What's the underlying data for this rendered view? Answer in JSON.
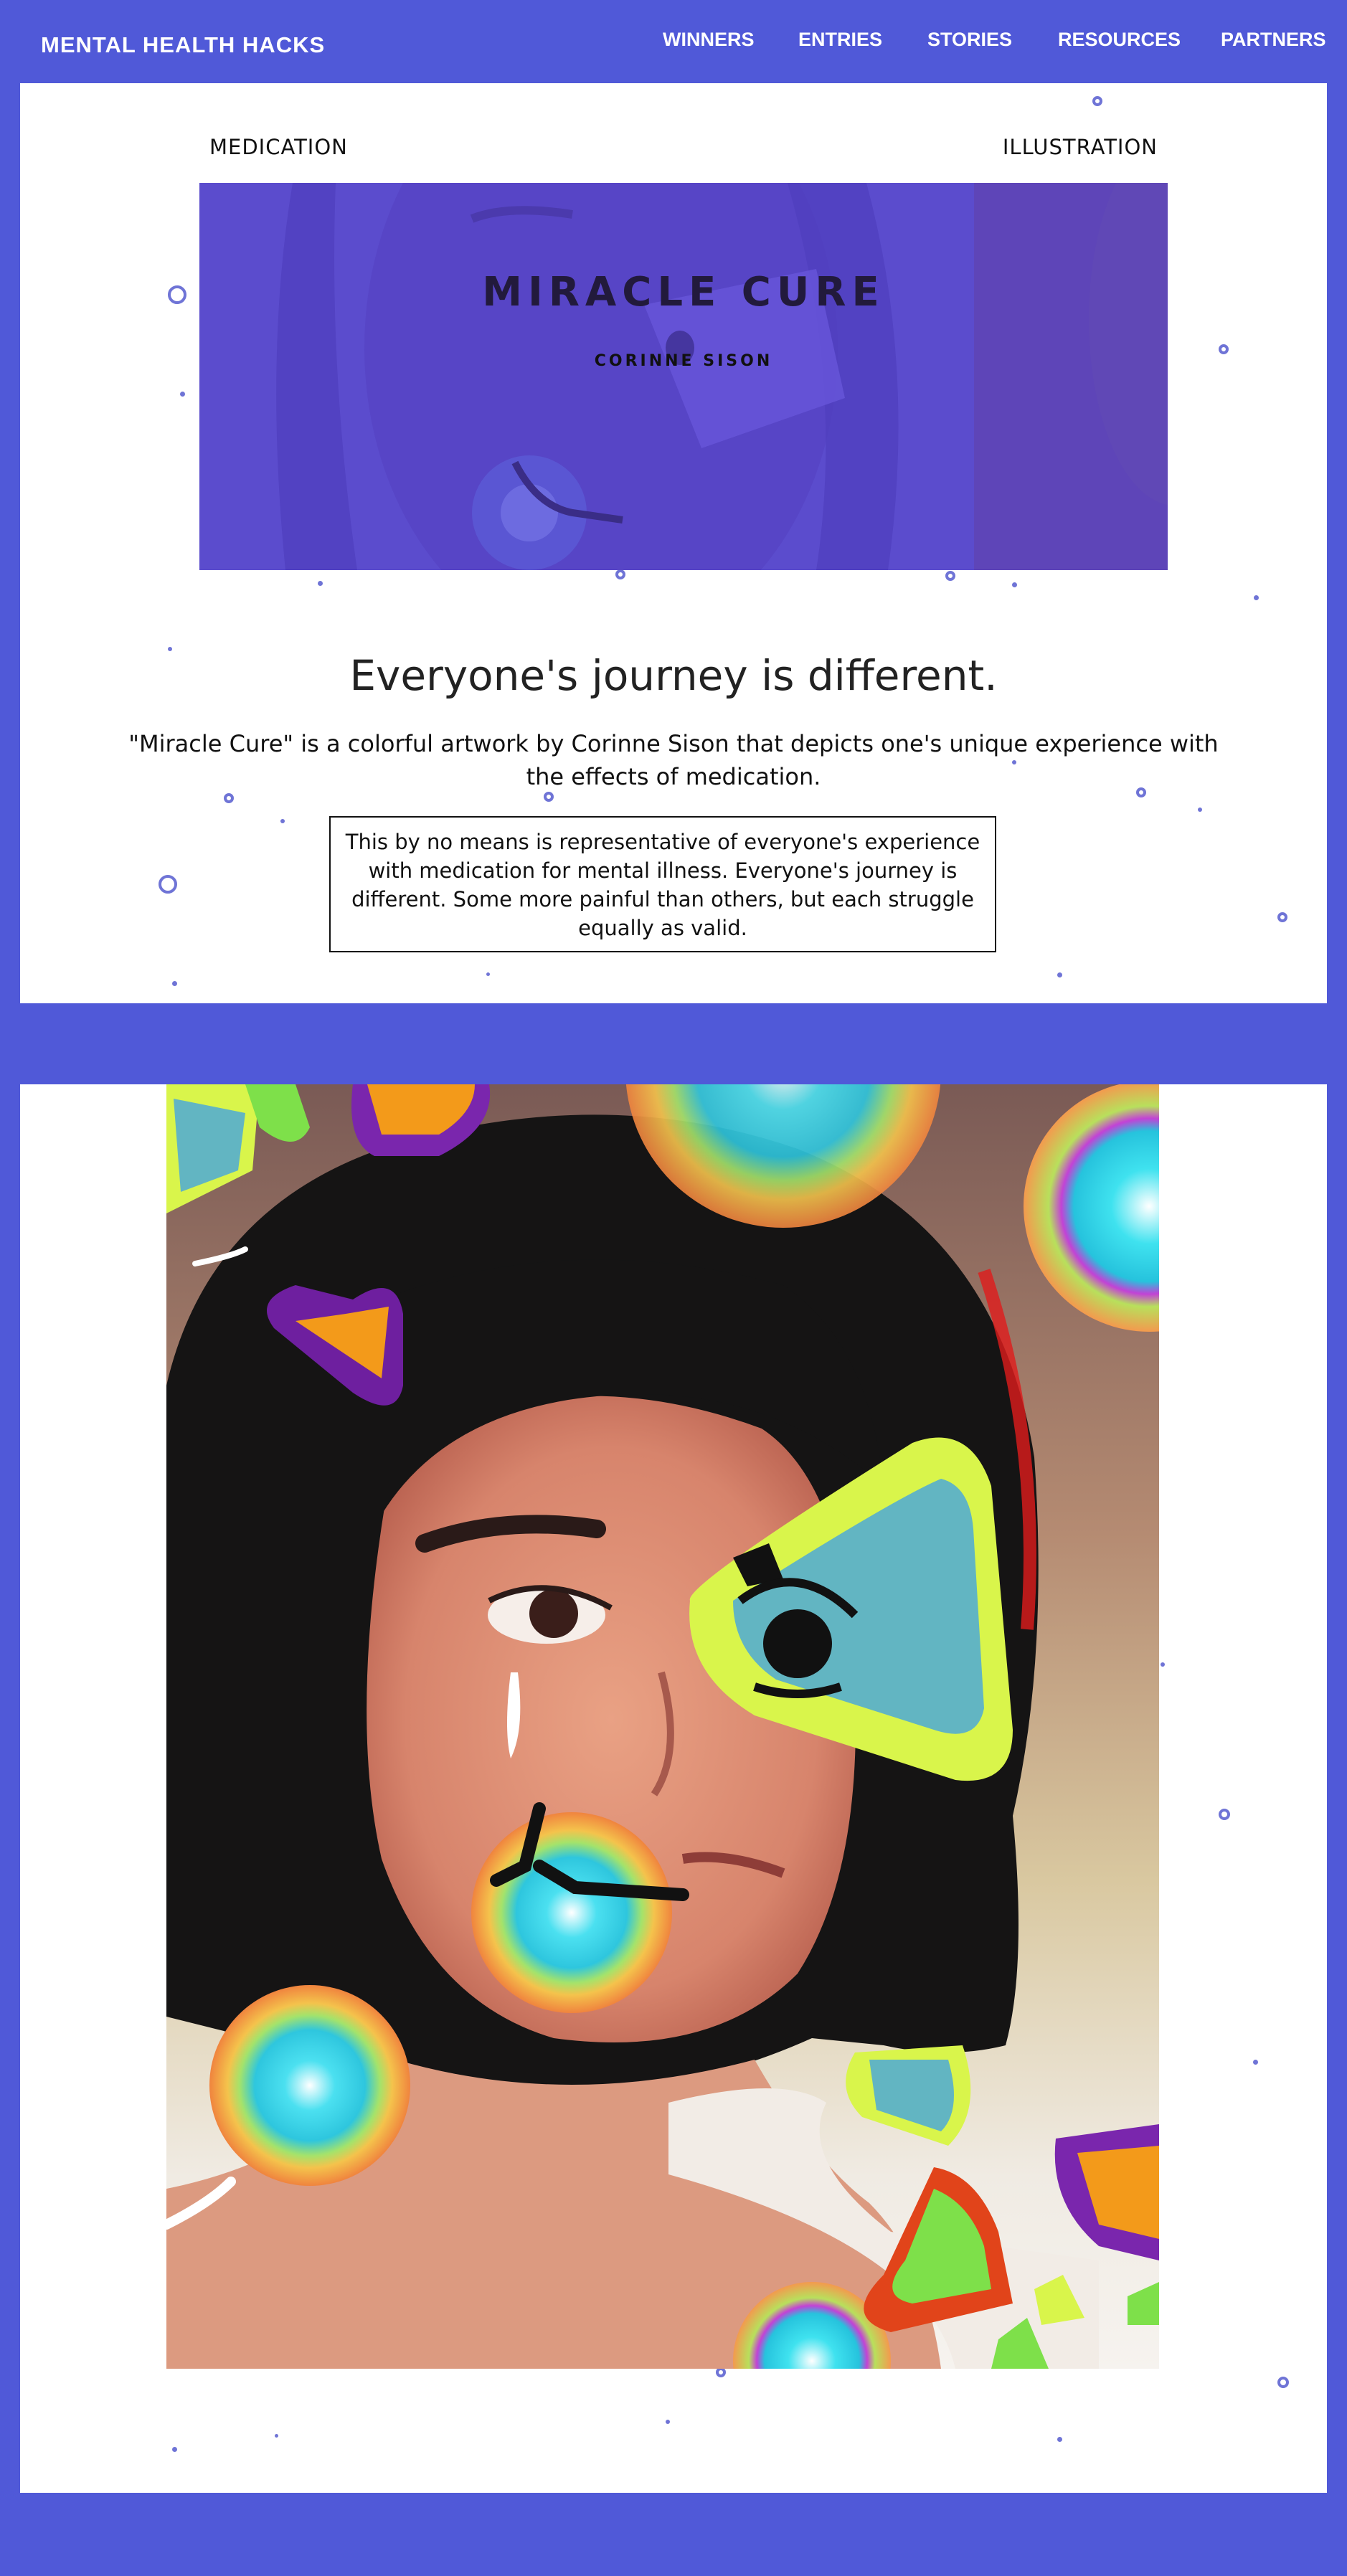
{
  "site": {
    "brand": "MENTAL HEALTH HACKS",
    "nav": [
      "WINNERS",
      "ENTRIES",
      "STORIES",
      "RESOURCES",
      "PARTNERS"
    ]
  },
  "entry": {
    "category_left": "MEDICATION",
    "category_right": "ILLUSTRATION",
    "title": "MIRACLE CURE",
    "author": "CORINNE SISON",
    "headline": "Everyone's journey is different.",
    "description": "\"Miracle Cure\" is a colorful artwork by Corinne Sison that depicts one's unique experience with the effects of medication.",
    "note": "This by no means is representative of everyone's experience with medication for mental illness. Everyone's journey is different. Some more painful than others, but each struggle equally as valid."
  },
  "colors": {
    "page_background": "#5059d8",
    "card_background": "#ffffff",
    "hero_overlay": "#5a4dd0",
    "dot": "#6f74d6"
  }
}
